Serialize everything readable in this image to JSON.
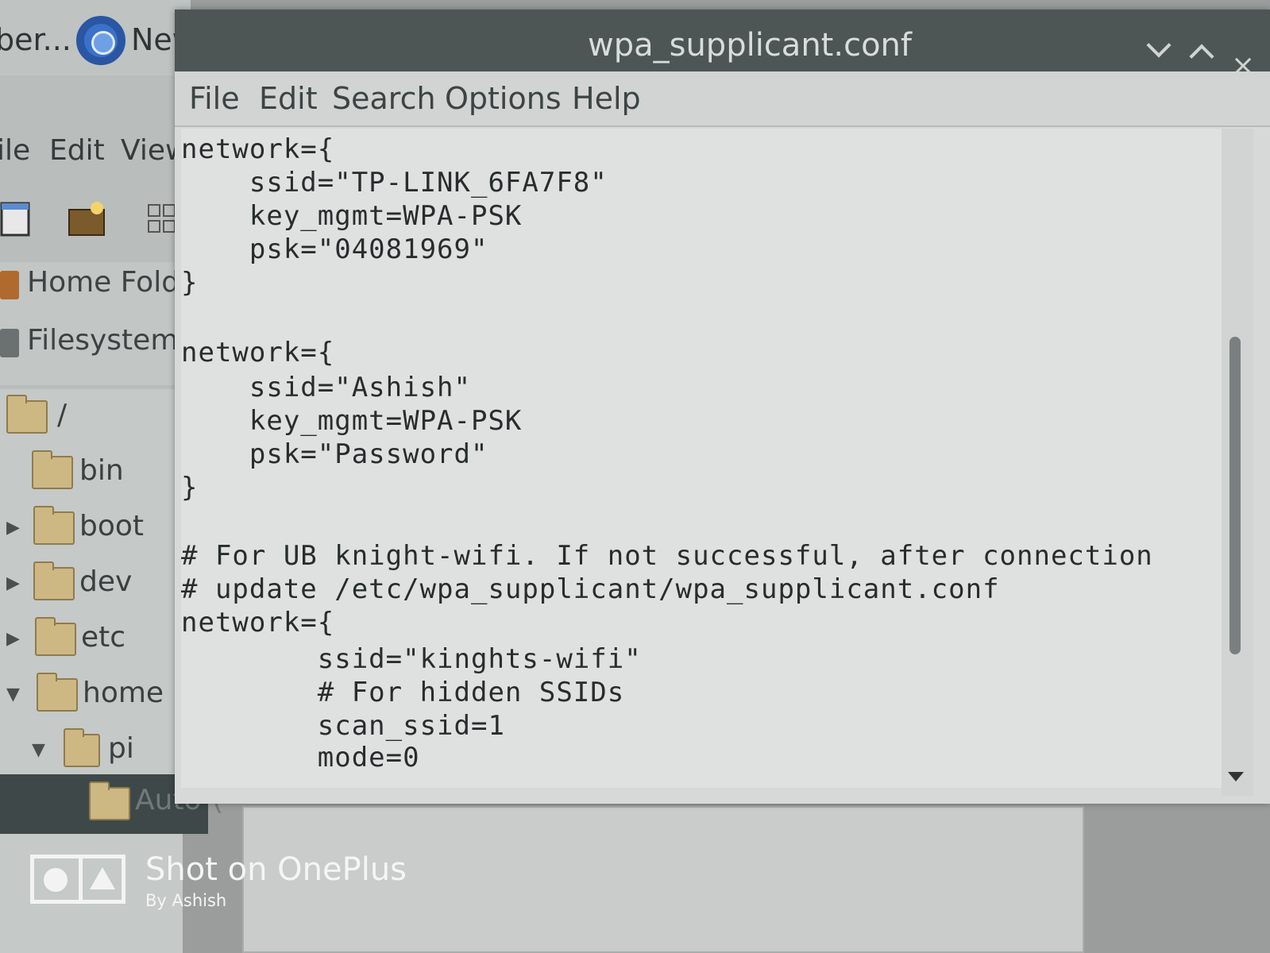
{
  "taskbar": {
    "items": [
      {
        "label": "ber..."
      },
      {
        "label": "New"
      }
    ]
  },
  "file_manager": {
    "menu": [
      "ile",
      "Edit",
      "View"
    ],
    "places": [
      {
        "label": "Home Folde",
        "icon": "home-folder-icon"
      },
      {
        "label": "Filesystem F",
        "icon": "drive-icon"
      }
    ],
    "tree": [
      {
        "label": "/"
      },
      {
        "label": "bin"
      },
      {
        "label": "boot"
      },
      {
        "label": "dev"
      },
      {
        "label": "etc"
      },
      {
        "label": "home"
      },
      {
        "label": "pi"
      },
      {
        "label": "Auto-("
      }
    ]
  },
  "editor": {
    "title": "wpa_supplicant.conf",
    "menu": [
      "File",
      "Edit",
      "Search",
      "Options",
      "Help"
    ],
    "lines": [
      "network={",
      "    ssid=\"TP-LINK_6FA7F8\"",
      "    key_mgmt=WPA-PSK",
      "    psk=\"04081969\"",
      "}",
      "",
      "network={",
      "    ssid=\"Ashish\"",
      "    key_mgmt=WPA-PSK",
      "    psk=\"Password\"",
      "}",
      "",
      "# For UB knight-wifi. If not successful, after connection",
      "# update /etc/wpa_supplicant/wpa_supplicant.conf",
      "network={",
      "        ssid=\"kinghts-wifi\"",
      "        # For hidden SSIDs",
      "        scan_ssid=1",
      "        mode=0"
    ]
  },
  "watermark": {
    "title": "Shot on OnePlus",
    "subtitle": "By Ashish"
  }
}
